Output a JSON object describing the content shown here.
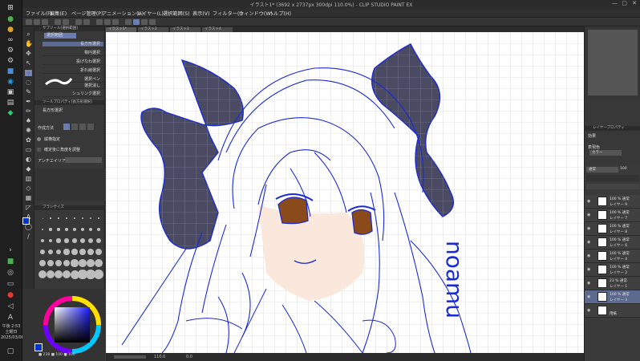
{
  "window": {
    "title": "イラスト1* (3692 x 2737px 300dpi 110.0%) - CLIP STUDIO PAINT EX"
  },
  "taskbar": {
    "time": "午後 2:53",
    "day": "土曜日",
    "date": "2025/03/08"
  },
  "menu": [
    "ファイル(F)",
    "編集(E)",
    "ページ管理(P)",
    "アニメーション(A)",
    "レイヤー(L)",
    "選択範囲(S)",
    "表示(V)",
    "フィルター(I)",
    "ウィンドウ(W)",
    "ヘルプ(H)"
  ],
  "tabs": [
    "イラスト1*",
    "イラスト2",
    "イラスト3",
    "イラスト4"
  ],
  "subtool": {
    "header": "サブツール[選択範囲]",
    "group": "選択範囲",
    "items": [
      "長方形選択",
      "楕円選択",
      "投げなわ選択",
      "折れ線選択",
      "選択ペン",
      "選択消し",
      "シュリンク選択"
    ]
  },
  "tool_property": {
    "header": "ツールプロパティ[長方形選択]",
    "name": "長方形選択",
    "creation_method": "作成方法",
    "aspect": "縦横指定",
    "fix_angle": "確定後に角度を調整",
    "antialias": "アンチエイリアス"
  },
  "brush_size": {
    "header": "ブラシサイズ"
  },
  "color": {
    "main": "#0033cc",
    "sub": "#ffffff",
    "readout": "■ 238  ■ 100  ■ 100"
  },
  "artwork": {
    "signature": "noamu"
  },
  "layer_property": {
    "header": "レイヤープロパティ",
    "effect": "効果",
    "expression": "表現色",
    "expression_value": "カラー"
  },
  "layers": {
    "blend": "通常",
    "opacity": "100",
    "items": [
      {
        "mode": "100 % 通常",
        "name": "レイヤー 9",
        "selected": false
      },
      {
        "mode": "100 % 通常",
        "name": "レイヤー 7",
        "selected": false
      },
      {
        "mode": "100 % 通常",
        "name": "レイヤー 8",
        "selected": false
      },
      {
        "mode": "100 % 通常",
        "name": "レイヤー 6",
        "selected": false
      },
      {
        "mode": "100 % 通常",
        "name": "レイヤー 4",
        "selected": false
      },
      {
        "mode": "100 % 通常",
        "name": "レイヤー 2",
        "selected": false
      },
      {
        "mode": "23 % 通常",
        "name": "レイヤー 1",
        "selected": false
      },
      {
        "mode": "100 % 通常",
        "name": "レイヤー 3",
        "selected": true
      },
      {
        "mode": "",
        "name": "用紙",
        "selected": false
      }
    ]
  },
  "status": {
    "zoom": "110.0",
    "angle": "0.0"
  }
}
